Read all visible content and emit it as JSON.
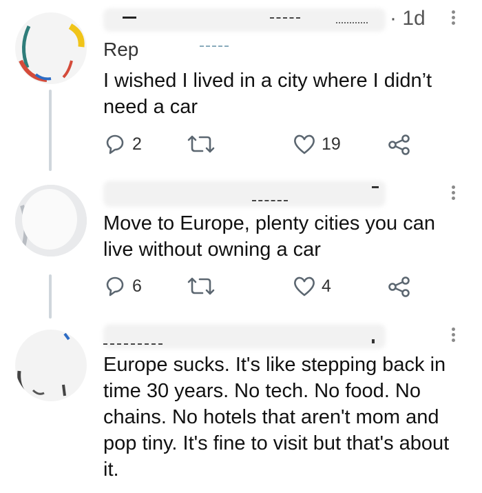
{
  "tweets": [
    {
      "id": "tweet-1",
      "partial_name": "Rep",
      "timestamp": "· 1d",
      "text_lines": [
        "I wished I lived in a city where I didn’t",
        "need a car"
      ],
      "actions": {
        "replies": "2",
        "likes": "19"
      }
    },
    {
      "id": "tweet-2",
      "text_lines": [
        "Move to Europe, plenty cities you can",
        "live without owning a car"
      ],
      "actions": {
        "replies": "6",
        "likes": "4"
      }
    },
    {
      "id": "tweet-3",
      "text_lines": [
        "Europe sucks.  It's like stepping back in",
        "time 30 years.  No tech.  No food.  No",
        "chains.  No hotels that aren't mom and",
        "pop tiny.  It's fine to visit but that's about",
        "it."
      ]
    }
  ],
  "icons": {
    "reply": "reply-icon",
    "retweet": "retweet-icon",
    "like": "heart-icon",
    "share": "share-icon",
    "more": "more-vertical-icon"
  },
  "colors": {
    "icon": "#5b6670",
    "thread_line": "#cfd6dc"
  }
}
